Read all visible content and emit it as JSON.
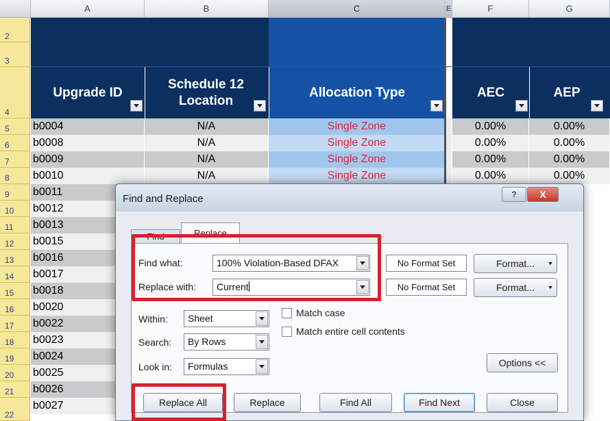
{
  "spreadsheet": {
    "columns": [
      "A",
      "B",
      "C",
      "E",
      "F",
      "G"
    ],
    "headers": {
      "upgrade_id": "Upgrade ID",
      "location": "Schedule 12 Location",
      "allocation_type": "Allocation Type",
      "aec": "AEC",
      "aep": "AEP"
    },
    "header_rows": [
      "2",
      "3",
      "4"
    ],
    "rows": [
      {
        "num": "5",
        "id": "b0004",
        "location": "N/A",
        "allocation": "Single Zone",
        "aec": "0.00%",
        "aep": "0.00%"
      },
      {
        "num": "6",
        "id": "b0008",
        "location": "N/A",
        "allocation": "Single Zone",
        "aec": "0.00%",
        "aep": "0.00%"
      },
      {
        "num": "7",
        "id": "b0009",
        "location": "N/A",
        "allocation": "Single Zone",
        "aec": "0.00%",
        "aep": "0.00%"
      },
      {
        "num": "8",
        "id": "b0010",
        "location": "N/A",
        "allocation": "Single Zone",
        "aec": "0.00%",
        "aep": "0.00%"
      },
      {
        "num": "9",
        "id": "b0011"
      },
      {
        "num": "10",
        "id": "b0012"
      },
      {
        "num": "11",
        "id": "b0013"
      },
      {
        "num": "12",
        "id": "b0015"
      },
      {
        "num": "13",
        "id": "b0016"
      },
      {
        "num": "14",
        "id": "b0017"
      },
      {
        "num": "15",
        "id": "b0018"
      },
      {
        "num": "16",
        "id": "b0020"
      },
      {
        "num": "17",
        "id": "b0022"
      },
      {
        "num": "18",
        "id": "b0023"
      },
      {
        "num": "19",
        "id": "b0024"
      },
      {
        "num": "20",
        "id": "b0025"
      },
      {
        "num": "21",
        "id": "b0026"
      },
      {
        "num": "22",
        "id": "b0027"
      }
    ]
  },
  "dialog": {
    "title": "Find and Replace",
    "help_label": "?",
    "close_label": "X",
    "tabs": {
      "find": "Find",
      "replace": "Replace"
    },
    "find_what_label": "Find what:",
    "find_what_value": "100% Violation-Based DFAX",
    "replace_with_label": "Replace with:",
    "replace_with_value": "Current",
    "no_format": "No Format Set",
    "format_button": "Format...",
    "within_label": "Within:",
    "within_value": "Sheet",
    "search_label": "Search:",
    "search_value": "By Rows",
    "look_in_label": "Look in:",
    "look_in_value": "Formulas",
    "match_case_label": "Match case",
    "match_entire_label": "Match entire cell contents",
    "options_button": "Options <<",
    "buttons": {
      "replace_all": "Replace All",
      "replace": "Replace",
      "find_all": "Find All",
      "find_next": "Find Next",
      "close": "Close"
    }
  },
  "colors": {
    "header_navy": "#0b2f5f",
    "selected_column": "#1452a5",
    "allocation_text": "#e0243b",
    "highlight_red": "#d8202f"
  }
}
